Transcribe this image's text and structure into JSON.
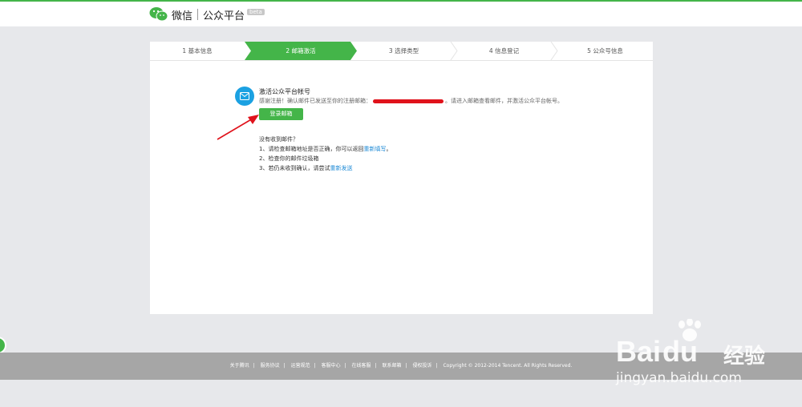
{
  "header": {
    "brand": "微信",
    "product": "公众平台",
    "badge": "beta"
  },
  "steps": [
    {
      "label": "1 基本信息",
      "active": false
    },
    {
      "label": "2 邮箱激活",
      "active": true
    },
    {
      "label": "3 选择类型",
      "active": false
    },
    {
      "label": "4 信息登记",
      "active": false
    },
    {
      "label": "5 公众号信息",
      "active": false
    }
  ],
  "activation": {
    "title": "激活公众平台帐号",
    "desc_prefix": "感谢注册！确认邮件已发送至你的注册邮箱：",
    "desc_suffix": "。请进入邮箱查看邮件，并激活公众平台帐号。",
    "login_button": "登录邮箱"
  },
  "help": {
    "heading": "没有收到邮件？",
    "item1_prefix": "1、请检查邮箱地址是否正确，你可以返回",
    "item1_link": "重新填写",
    "item1_suffix": "。",
    "item2": "2、检查你的邮件垃圾箱",
    "item3_prefix": "3、若仍未收到确认，请尝试",
    "item3_link": "重新发送"
  },
  "footer": {
    "links": [
      "关于腾讯",
      "服务协议",
      "运营规范",
      "客服中心",
      "在线客服",
      "联系邮箱",
      "侵权投诉"
    ],
    "copyright": "Copyright © 2012-2014 Tencent. All Rights Reserved."
  },
  "watermark": {
    "main": "Bai",
    "main2": "du",
    "cn": "经验",
    "url": "jingyan.baidu.com"
  },
  "colors": {
    "accent": "#44b549",
    "link": "#1e8ad6",
    "mail_icon": "#1ba1e2",
    "arrow": "#e0121b"
  }
}
